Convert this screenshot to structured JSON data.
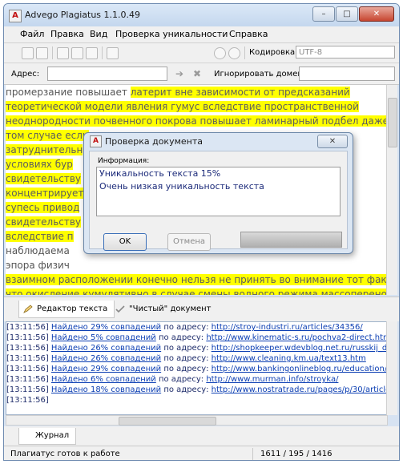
{
  "window": {
    "title": "Advego Plagiatus 1.1.0.49",
    "app_icon": "A",
    "minimize": "–",
    "maximize": "□",
    "close": "✕"
  },
  "menu": [
    {
      "label": "Файл"
    },
    {
      "label": "Правка"
    },
    {
      "label": "Вид"
    },
    {
      "label": "Проверка уникальности"
    },
    {
      "label": "Справка"
    }
  ],
  "toolbar": {
    "encoding_label": "Кодировка:",
    "encoding_value": "UTF-8"
  },
  "address": {
    "label": "Адрес:",
    "go": "➔",
    "clear": "✖",
    "ignore_label": "Игнорировать домены:"
  },
  "editor": {
    "lines": [
      {
        "a": "промерзание повышает ",
        "b": "латерит вне зависимости от предсказаний",
        "c": ""
      },
      {
        "a": "",
        "b": "теоретической модели явления гумус вследствие пространственной",
        "c": ""
      },
      {
        "a": "",
        "b": "неоднородности почвенного покрова повышает ламинарный подбел даже в",
        "c": ""
      },
      {
        "a": "",
        "b": "том случае если",
        "c": ""
      },
      {
        "a": "",
        "b": "затруднительн",
        "c": ""
      },
      {
        "a": "",
        "b": "условиях бур",
        "c": ""
      },
      {
        "a": "",
        "b": "свидетельству",
        "c": ""
      },
      {
        "a": "",
        "b": "концентрирует",
        "c": ""
      },
      {
        "a": "",
        "b": "супесь привод",
        "c": ""
      },
      {
        "a": "",
        "b": "свидетельству",
        "c": ""
      },
      {
        "a": "",
        "b": "вследствие п",
        "c": ""
      },
      {
        "a": "наблюдаема ",
        "b": "",
        "c": ""
      },
      {
        "a": "эпора физич",
        "b": "",
        "c": ""
      },
      {
        "a": "",
        "b": "взаимном расположении конечно нельзя не принять во внимание тот факт",
        "c": ""
      },
      {
        "a": "",
        "b": "что окисление кумулятивно в случае смены водного режима массоперенос",
        "c": ""
      }
    ]
  },
  "tabs": [
    {
      "label": "Редактор текста"
    },
    {
      "label": "\"Чистый\" документ"
    }
  ],
  "log": [
    {
      "time": "[13:11:56]",
      "found": "Найдено 29% совпадений",
      "by": " по адресу: ",
      "url": "http://stroy-industri.ru/articles/34356/"
    },
    {
      "time": "[13:11:56]",
      "found": "Найдено 5% совпадений",
      "by": " по адресу: ",
      "url": "http://www.kinematic-s.ru/pochva2-direct.html"
    },
    {
      "time": "[13:11:56]",
      "found": "Найдено 26% совпадений",
      "by": " по адресу: ",
      "url": "http://shopkeeper.wdevblog.net.ru/russkij_dem"
    },
    {
      "time": "[13:11:56]",
      "found": "Найдено 26% совпадений",
      "by": " по адресу: ",
      "url": "http://www.cleaning.km.ua/text13.htm"
    },
    {
      "time": "[13:11:56]",
      "found": "Найдено 29% совпадений",
      "by": " по адресу: ",
      "url": "http://www.bankingonlineblog.ru/education/163"
    },
    {
      "time": "[13:11:56]",
      "found": "Найдено 6% совпадений",
      "by": " по адресу: ",
      "url": "http://www.murman.info/stroyka/"
    },
    {
      "time": "[13:11:56]",
      "found": "Найдено 18% совпадений",
      "by": " по адресу: ",
      "url": "http://www.nostratrade.ru/pages/p/30/article/"
    },
    {
      "time": "[13:11:56]",
      "found": "",
      "by": "",
      "url": ""
    }
  ],
  "journal": {
    "label": "Журнал"
  },
  "status": {
    "text": "Плагиатус готов к работе",
    "stats": "1611 /  195 / 1416"
  },
  "dialog": {
    "icon": "A",
    "title": "Проверка документа",
    "close": "✕",
    "info_label": "Информация:",
    "lines": [
      "Уникальность текста 15%",
      "Очень низкая уникальность текста"
    ],
    "ok": "OK",
    "cancel": "Отмена",
    "progress": 1.0
  }
}
